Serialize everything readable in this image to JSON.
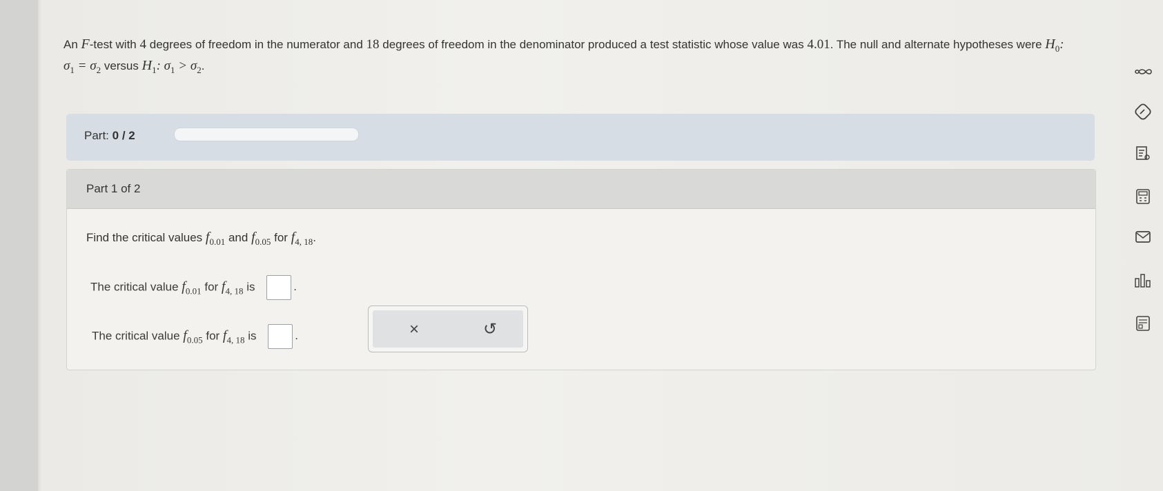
{
  "problem": {
    "intro_1": "An",
    "intro_F": "F",
    "intro_2": "-test with",
    "df_num": "4",
    "intro_3": "degrees of freedom in the numerator and",
    "df_den": "18",
    "intro_4": "degrees of freedom in the denominator produced a test statistic whose value was",
    "statistic": "4.01",
    "intro_5": ". The null and alternate hypotheses were",
    "h0": "H",
    "h0_sub": "0",
    "h0_rel": ": σ",
    "s1_sub": "1",
    "eq": " = σ",
    "s2_sub": "2",
    "versus": " versus ",
    "h1": "H",
    "h1_sub": "1",
    "h1_rel": ": σ",
    "gt": " > σ",
    "end": "."
  },
  "part_bar": {
    "label": "Part:",
    "progress_text": "0 / 2",
    "progress_fraction": 0.0
  },
  "card": {
    "header": "Part 1 of 2",
    "prompt_a": "Find the critical values",
    "f": "f",
    "f001_sub": "0.01",
    "and": "and",
    "f005_sub": "0.05",
    "for": "for",
    "f418_sub": "4, 18",
    "prompt_end": ".",
    "line1_a": "The critical value",
    "line1_is": "is",
    "line2_a": "The critical value",
    "line2_is": "is",
    "period": "."
  },
  "actions": {
    "clear": "×",
    "undo": "↺"
  },
  "toolbar_icons": [
    "infinity-icon",
    "pencil-icon",
    "notes-icon",
    "calculator-icon",
    "mail-icon",
    "chart-icon",
    "datasheet-icon"
  ]
}
